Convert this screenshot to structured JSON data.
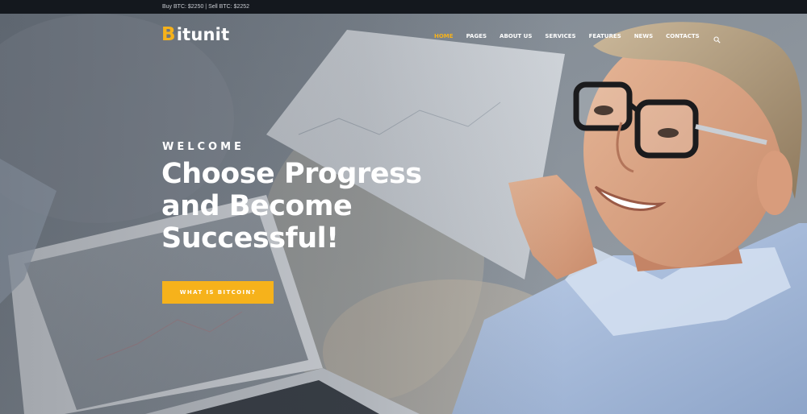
{
  "topbar": {
    "prices": "Buy BTC: $2250 | Sell BTC: $2252"
  },
  "header": {
    "logo_initial": "B",
    "logo_rest": "itunit",
    "nav": [
      {
        "label": "HOME",
        "active": true
      },
      {
        "label": "PAGES",
        "active": false
      },
      {
        "label": "ABOUT US",
        "active": false
      },
      {
        "label": "SERVICES",
        "active": false
      },
      {
        "label": "FEATURES",
        "active": false
      },
      {
        "label": "NEWS",
        "active": false
      },
      {
        "label": "CONTACTS",
        "active": false
      }
    ],
    "search_icon": "search-icon"
  },
  "hero": {
    "eyebrow": "WELCOME",
    "headline_lines": [
      "Choose Progress",
      "and Become",
      "Successful!"
    ],
    "cta_label": "WHAT IS BITCOIN?",
    "image": "smiling man with glasses holding papers beside a laptop"
  },
  "colors": {
    "accent": "#f6b21b",
    "topbar_bg": "#14181e",
    "text": "#ffffff"
  }
}
